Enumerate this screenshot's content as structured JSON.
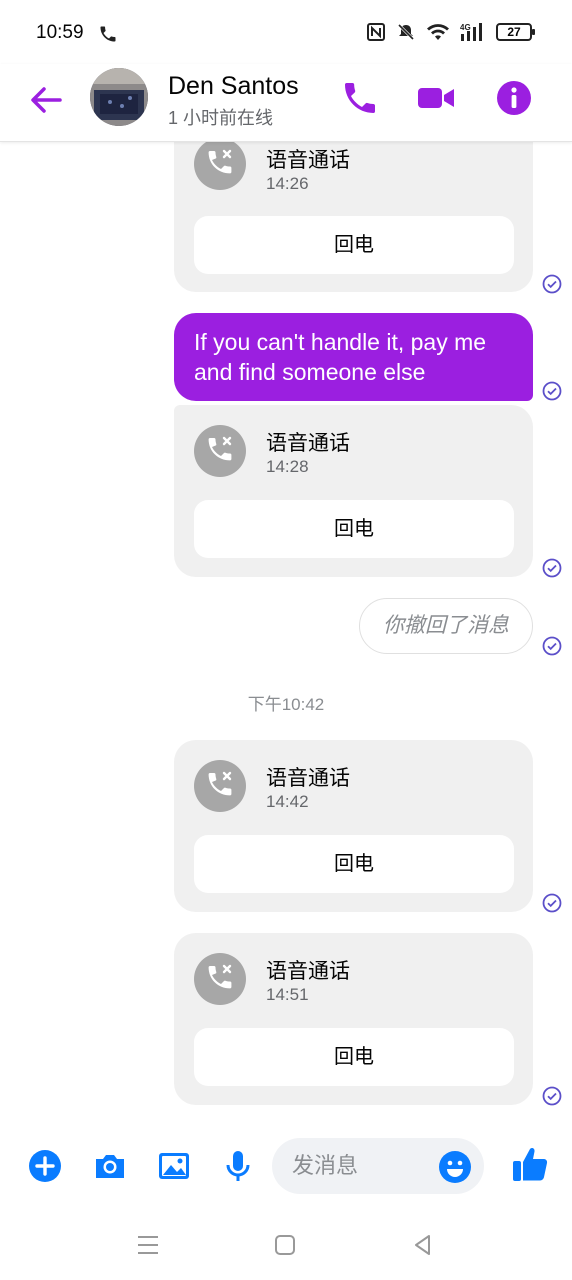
{
  "status_bar": {
    "time": "10:59",
    "battery": "27",
    "network": "4G"
  },
  "header": {
    "contact_name": "Den Santos",
    "contact_status": "1 小时前在线"
  },
  "messages": {
    "call_title": "语音通话",
    "callback_label": "回电",
    "calls": [
      {
        "time": "14:26"
      },
      {
        "time": "14:28"
      },
      {
        "time": "14:42"
      },
      {
        "time": "14:51"
      }
    ],
    "text_message": "If you can't handle it, pay me and find someone else",
    "unsent_label": "你撤回了消息",
    "separator_time": "下午10:42"
  },
  "composer": {
    "placeholder": "发消息"
  },
  "colors": {
    "accent": "#9b1fe0",
    "blue": "#0a7cff",
    "check": "#5b4fc9"
  }
}
